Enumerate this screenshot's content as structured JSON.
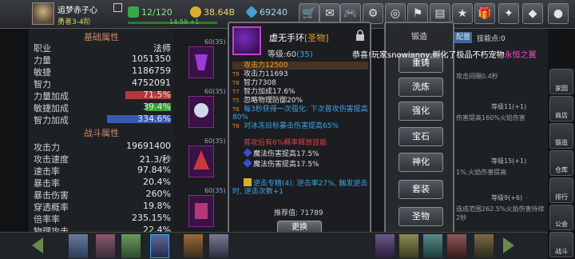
{
  "player": {
    "name": "追梦赤子心",
    "rank": "勇者3-4阶",
    "energy": "12/120",
    "gold": "38.64В",
    "gems": "69240",
    "exp_rate": "14:59 +1"
  },
  "attributes": {
    "base_title": "基础属性",
    "combat_title": "战斗属性",
    "base": [
      {
        "label": "职业",
        "value": "法师"
      },
      {
        "label": "力量",
        "value": "1051350"
      },
      {
        "label": "敏捷",
        "value": "1186759"
      },
      {
        "label": "智力",
        "value": "4752091"
      },
      {
        "label": "力量加成",
        "value": "71.5%",
        "fill": 0.715,
        "color": "#b03a3a"
      },
      {
        "label": "敏捷加成",
        "value": "39.4%",
        "fill": 0.394,
        "color": "#3a9a3a"
      },
      {
        "label": "智力加成",
        "value": "334.6%",
        "fill": 1.0,
        "color": "#3a5ab0"
      }
    ],
    "combat": [
      {
        "label": "攻击力",
        "value": "19691400"
      },
      {
        "label": "攻击速度",
        "value": "21.3/秒"
      },
      {
        "label": "速击率",
        "value": "97.84%"
      },
      {
        "label": "暴击率",
        "value": "20.4%"
      },
      {
        "label": "暴击伤害",
        "value": "260%"
      },
      {
        "label": "穿透概率",
        "value": "19.8%"
      },
      {
        "label": "倍率率",
        "value": "235.15%"
      },
      {
        "label": "物理攻击",
        "value": "22.4%"
      }
    ]
  },
  "equipment_slots": [
    {
      "level": "60(35)",
      "tag": "圣五",
      "color": "#c940c9"
    },
    {
      "level": "60(35)",
      "tag": "圣五",
      "color": "#c940c9"
    },
    {
      "level": "60(35)",
      "tag": "圣五",
      "color": "#c940c9"
    },
    {
      "level": "60(35)",
      "tag": "圣五",
      "color": "#c940c9"
    }
  ],
  "item": {
    "name": "虚无手环",
    "tag": "[圣物]",
    "level_label": "等级:",
    "level": "60",
    "level_plus": "(35)",
    "stats": [
      {
        "tier": "",
        "text": "攻击力12500",
        "color": "#f0a030",
        "highlight": true
      },
      {
        "tier": "T8",
        "text": "攻击力11693",
        "color": "#e0e0e0"
      },
      {
        "tier": "T8",
        "text": "智力7308",
        "color": "#e0e0e0"
      },
      {
        "tier": "T7",
        "text": "智力加成17.6%",
        "color": "#e0e0e0"
      },
      {
        "tier": "T5",
        "text": "忽略物理防御20%",
        "color": "#e0e0e0"
      },
      {
        "tier": "T6",
        "text": "每3秒获得一次强化: 下次普攻伤害提高80%",
        "color": "#3ea6e6"
      },
      {
        "tier": "T8",
        "text": "对冰冻目标暴击伤害提高65%",
        "color": "#3ea6e6"
      },
      {
        "tier": "",
        "text": "普攻后有6%概率释放技能",
        "color": "#e04040"
      },
      {
        "tier": "",
        "text": "魔法伤害提高17.5%",
        "color": "#e0e0e0",
        "gem": true
      },
      {
        "tier": "",
        "text": "魔法伤害提高17.5%",
        "color": "#e0e0e0",
        "gem": true
      },
      {
        "tier": "",
        "text": "逆击专精(4): 逆击率27%, 触发逆击时, 逆击次数+1",
        "color": "#3ea6e6",
        "set": true
      }
    ],
    "recommend_label": "推荐值:",
    "recommend_value": "71789",
    "replace_label": "更换"
  },
  "forge": {
    "title": "锻造",
    "buttons": [
      "重铸",
      "洗炼",
      "强化",
      "宝石",
      "神化",
      "套装",
      "圣物"
    ]
  },
  "notice": {
    "prefix": "恭喜!玩家snowianny,孵化了极品不朽宠物",
    "highlight": "永恒之翼"
  },
  "skills": {
    "tab_label": "配置",
    "points_label": "技能点:0",
    "rows": [
      {
        "text": "攻击间隔0.4秒"
      },
      {
        "text": "等级11(+1)"
      },
      {
        "text": "伤害提高160%火焰伤害"
      },
      {
        "text": "等级15(+1)"
      },
      {
        "text": "1%,火焰伤害提高"
      },
      {
        "text": "等级9(+6)"
      },
      {
        "text": "造成范围262.5%火焰伤害持续2秒"
      }
    ]
  },
  "nav": [
    "家园",
    "商店",
    "锻造",
    "仓库",
    "排行",
    "公会",
    "战斗"
  ]
}
